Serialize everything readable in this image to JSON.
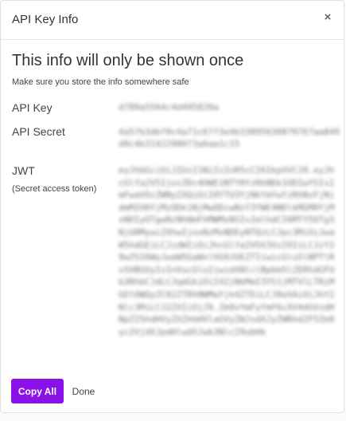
{
  "modal": {
    "title": "API Key Info",
    "close_glyph": "×",
    "close_icon": "close-icon",
    "headline": "This info will only be shown once",
    "subline": "Make sure you store the info somewhere safe"
  },
  "fields": {
    "api_key": {
      "label": "API Key",
      "value": "d789a5564c4d495820a"
    },
    "api_secret": {
      "label": "API Secret",
      "value": "4a57b3dbf0c4a71c67f3e4b33895630870767aa849d0c4b3142298073a6aa1c15"
    },
    "jwt": {
      "label": "JWT",
      "sublabel": "(Secret access token)",
      "value": "eyJhbGciOiJIUzI1NiIsInR5cCI6IkpXVCJ9.eyJhcGlfa2V5IjoiZDc4OWE1NTY0YzRkNDk1ODIwYSIsImFwaV9zZWNyZXQiOiI0YTU3YjNkYmYwYzRhNzFjNjdmM2U0YjMzODk1NjMwODcwNzY3YWE4NDlkMGM0YjMxNDIyOTgwNzNhNmFhMWMxNSIsImlhdCI6MTY5OTg3NjU0MywiZXhwIjoxNzMxNDEyNTQzLCJpc3MiOiJwaW5hdGEiLCJzdWIiOiJhcGlfa2V5X3VzZXIiLCJzY29wZSI6WyJwaW5GaWxlVG9JUEZTIiwicGluSlNPTlRvSVBGUyIsInVucGluIiwidXNlclBpbm5lZERhdGFUb3RhbCJdLCJqdGkiOiI4ZjNkMmI3YS1jMTVlLTRiMGEtOWQyZC02ZTRhNWMwYjk4ZTEiLCJ0eXAiOiJhY2Nlc3MiLCJ2ZXIiOjJ9.Zm9vYmFyYmF6cXV4dGVzdHNpZ25hdHVyZXZhbHVlaGVyZWJsdXJyZWRhd2F5Zm9yc2VjdXJpdHlwdXJwb3Nlc29ubHk"
    }
  },
  "actions": {
    "copy_all_label": "Copy All",
    "done_label": "Done"
  },
  "colors": {
    "accent": "#8a12e8"
  }
}
